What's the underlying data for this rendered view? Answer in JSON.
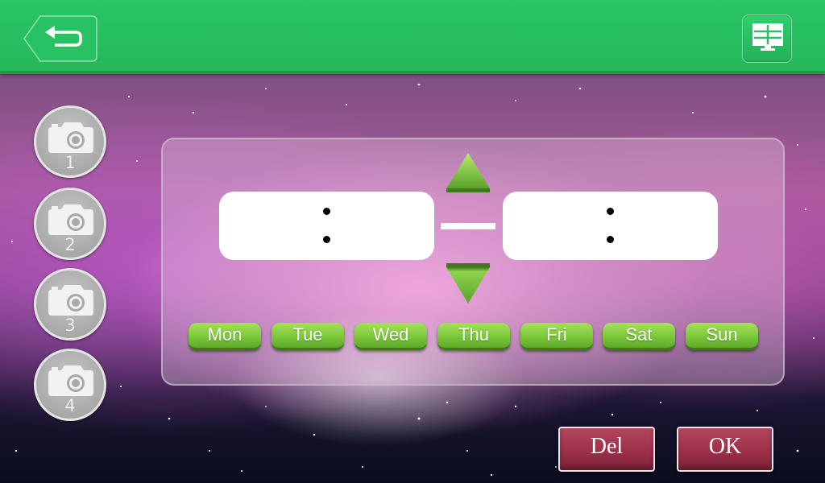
{
  "topbar": {
    "back_icon": "back-arrow-icon",
    "layout_icon": "grid-layout-icon",
    "accent_color": "#27c162"
  },
  "cameras": [
    {
      "number": "1",
      "icon": "camera-icon"
    },
    {
      "number": "2",
      "icon": "camera-icon"
    },
    {
      "number": "3",
      "icon": "camera-icon"
    },
    {
      "number": "4",
      "icon": "camera-icon"
    }
  ],
  "schedule": {
    "start_time": {
      "hours": "",
      "separator": ":",
      "minutes": ""
    },
    "end_time": {
      "hours": "",
      "separator": ":",
      "minutes": ""
    },
    "range_separator": "—",
    "up_icon": "triangle-up-icon",
    "down_icon": "triangle-down-icon",
    "days": [
      "Mon",
      "Tue",
      "Wed",
      "Thu",
      "Fri",
      "Sat",
      "Sun"
    ],
    "day_color": "#7bc83a"
  },
  "actions": {
    "delete_label": "Del",
    "ok_label": "OK",
    "button_color": "#9a2e48"
  }
}
